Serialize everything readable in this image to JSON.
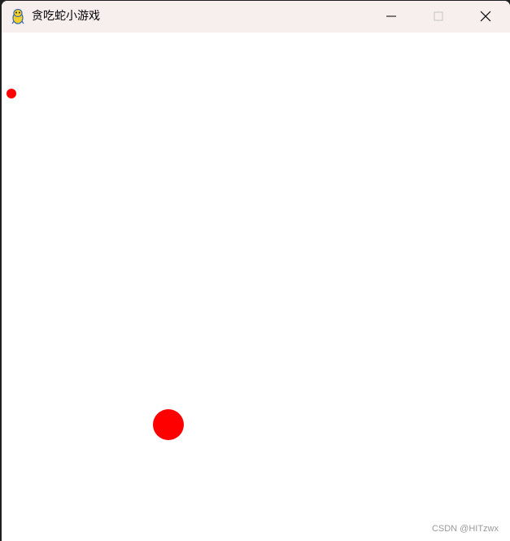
{
  "window": {
    "title": "贪吃蛇小游戏",
    "app_icon": "pygame-snake-icon",
    "controls": {
      "minimize_icon": "minimize-icon",
      "maximize_icon": "maximize-icon",
      "close_icon": "close-icon"
    }
  },
  "game": {
    "background_color": "#ffffff",
    "food": {
      "color": "#ff0000"
    },
    "snake": {
      "color": "#ff0000"
    }
  },
  "watermark": "CSDN @HITzwx"
}
